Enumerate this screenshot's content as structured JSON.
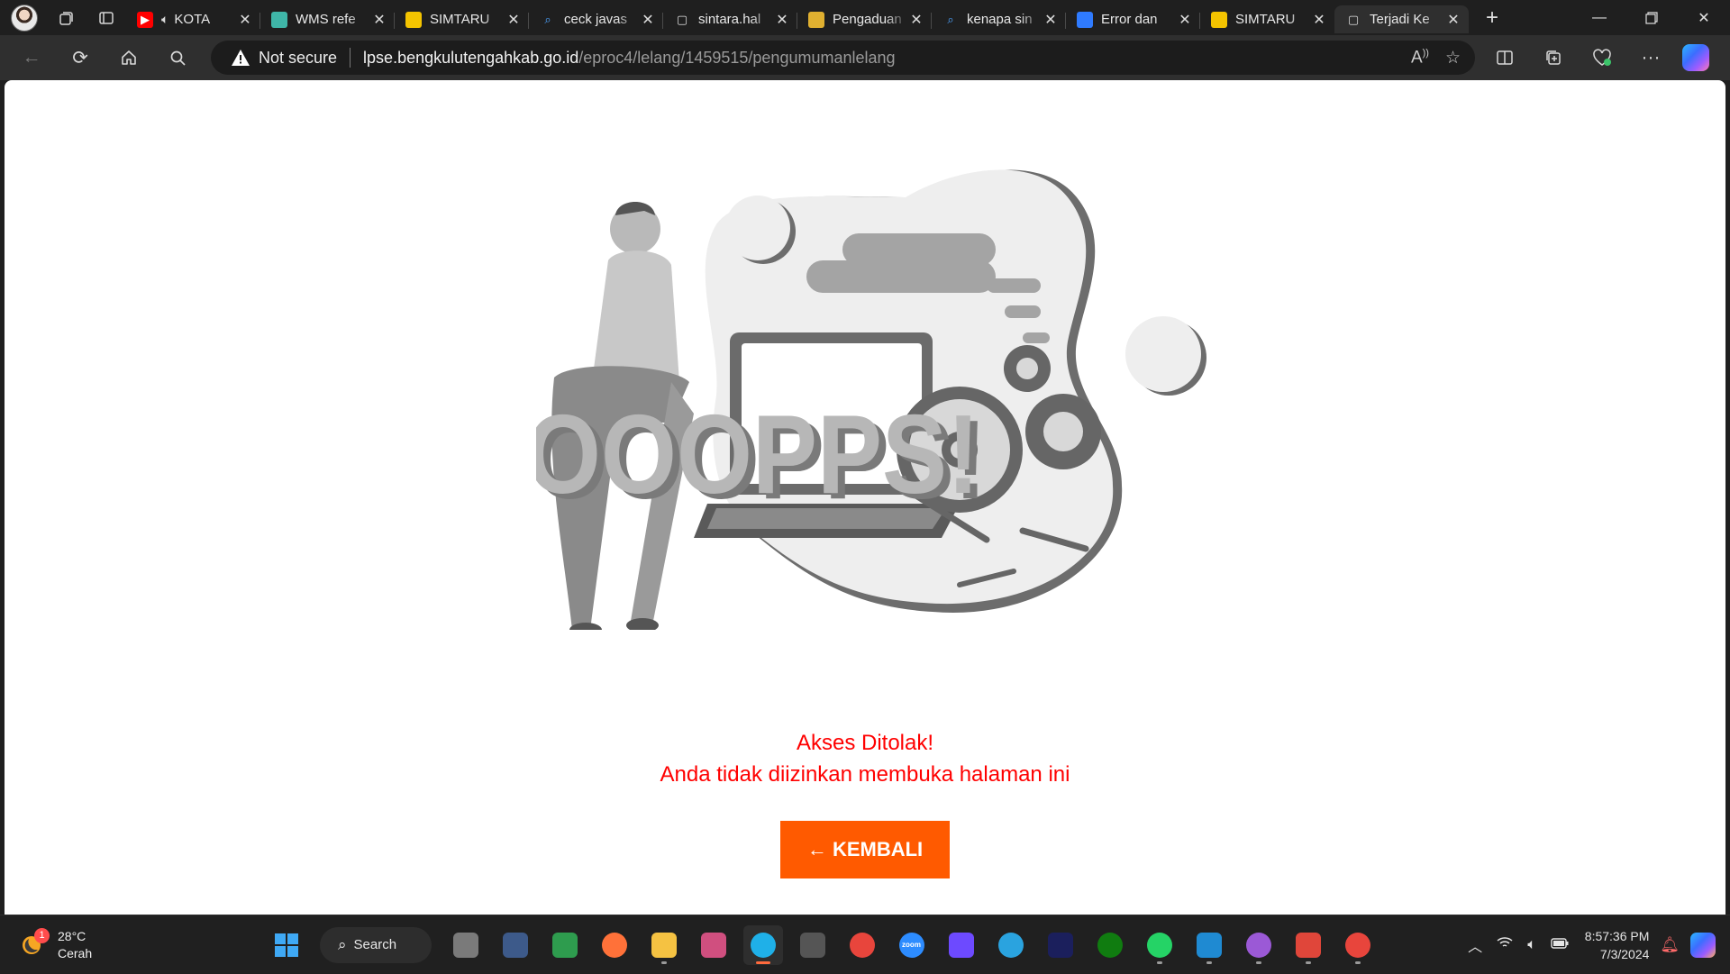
{
  "browser": {
    "tabs": [
      {
        "title": "KOTA",
        "icon": "youtube-icon",
        "color": "#ff0000",
        "playing_audio": true
      },
      {
        "title": "WMS refe",
        "icon": "map-globe-icon",
        "color": "#3fb6a8"
      },
      {
        "title": "SIMTARU",
        "icon": "simtaru-logo-icon",
        "color": "#f4c400"
      },
      {
        "title": "ceck javas",
        "icon": "search-icon",
        "color": "#4da3ff"
      },
      {
        "title": "sintara.hal",
        "icon": "document-icon",
        "color": "#dddddd"
      },
      {
        "title": "Pengaduan",
        "icon": "crest-icon",
        "color": "#e0b030"
      },
      {
        "title": "kenapa sin",
        "icon": "search-icon",
        "color": "#4da3ff"
      },
      {
        "title": "Error dan",
        "icon": "apps-icon",
        "color": "#2f7bff"
      },
      {
        "title": "SIMTARU",
        "icon": "simtaru-logo-icon",
        "color": "#f4c400"
      },
      {
        "title": "Terjadi Ke",
        "icon": "page-icon",
        "color": "#dddddd",
        "active": true
      }
    ],
    "security_label": "Not secure",
    "url_host": "lpse.bengkulutengahkab.go.id",
    "url_path": "/eproc4/lelang/1459515/pengumumanlelang"
  },
  "page": {
    "illustration_text": "OOOPPS!",
    "error_title": "Akses Ditolak!",
    "error_detail": "Anda tidak diizinkan membuka halaman ini",
    "back_label": "← KEMBALI",
    "button_color": "#ff5a00",
    "message_color": "#ff0000"
  },
  "taskbar": {
    "weather_temp": "28°C",
    "weather_desc": "Cerah",
    "weather_badge": "1",
    "search_label": "Search",
    "apps": [
      {
        "name": "task-view-icon",
        "color": "#7a7a7a",
        "running": false
      },
      {
        "name": "vpn-shield-icon",
        "color": "#3d5a8a",
        "running": false
      },
      {
        "name": "qgis-map-icon",
        "color": "#2e9c4e",
        "running": false
      },
      {
        "name": "firefox-icon",
        "color": "#ff7139",
        "running": false
      },
      {
        "name": "file-explorer-icon",
        "color": "#f5c242",
        "running": true
      },
      {
        "name": "snipping-tool-icon",
        "color": "#d04f7f",
        "running": false
      },
      {
        "name": "edge-icon",
        "color": "#1fb0e8",
        "running": true,
        "active": true
      },
      {
        "name": "terminal-icon",
        "color": "#555555",
        "running": false
      },
      {
        "name": "chrome-icon",
        "color": "#e8453c",
        "running": false
      },
      {
        "name": "zoom-icon",
        "color": "#2d8cff",
        "running": false,
        "label": "zoom"
      },
      {
        "name": "proton-icon",
        "color": "#6d4aff",
        "running": false
      },
      {
        "name": "telegram-icon",
        "color": "#2aa3df",
        "running": false
      },
      {
        "name": "webex-icon",
        "color": "#1b1f5c",
        "running": false
      },
      {
        "name": "xbox-icon",
        "color": "#107c10",
        "running": false
      },
      {
        "name": "whatsapp-icon",
        "color": "#25d366",
        "running": true
      },
      {
        "name": "vscode-icon",
        "color": "#1f8ad2",
        "running": true
      },
      {
        "name": "media-player-icon",
        "color": "#9b59d6",
        "running": true
      },
      {
        "name": "pdf-tool-icon",
        "color": "#e0463a",
        "running": true
      },
      {
        "name": "chrome-profile-icon",
        "color": "#e8453c",
        "running": true
      }
    ],
    "time": "8:57:36 PM",
    "date": "7/3/2024"
  }
}
